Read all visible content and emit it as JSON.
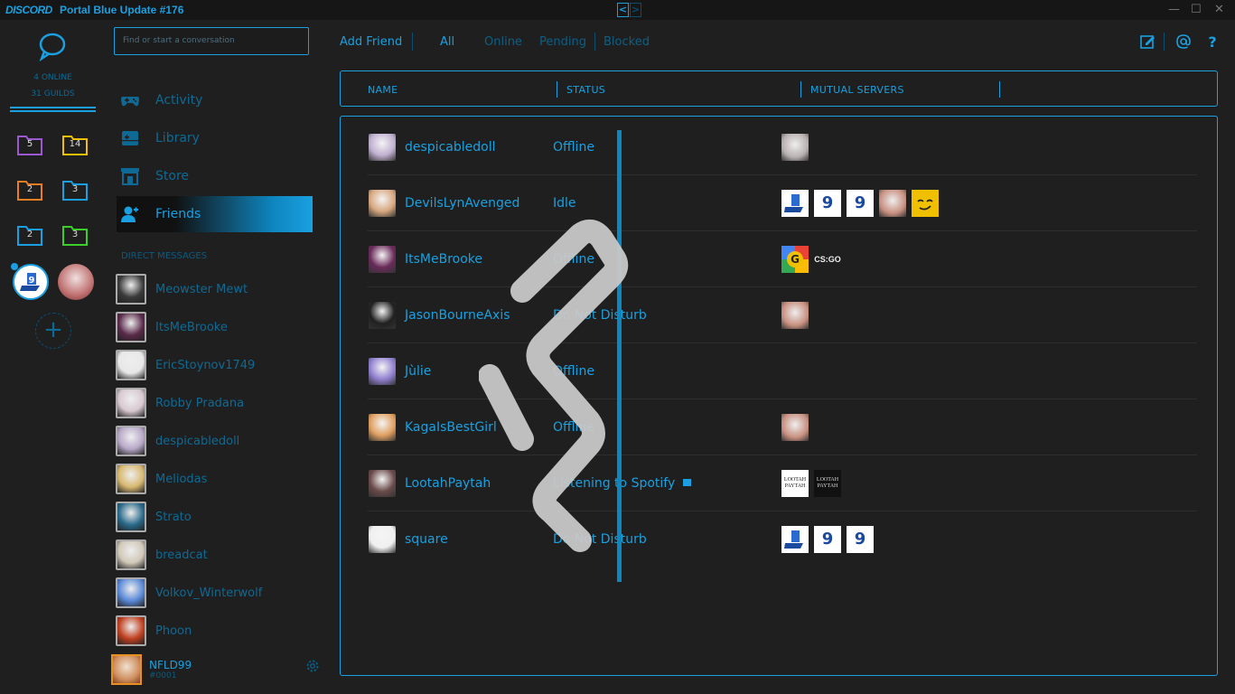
{
  "window": {
    "logo": "DISCORD",
    "title": "Portal Blue Update #176",
    "nav_back": "<",
    "nav_forward": ">",
    "minimize": "—",
    "maximize": "☐",
    "close": "✕"
  },
  "guilds": {
    "online_count": "4 ONLINE",
    "guild_count": "31 GUILDS",
    "folders": [
      {
        "count": "5",
        "color": "#9b59d0"
      },
      {
        "count": "14",
        "color": "#f0c000"
      },
      {
        "count": "2",
        "color": "#e87e22"
      },
      {
        "count": "3",
        "color": "#1aa0e0"
      },
      {
        "count": "2",
        "color": "#1aa0e0"
      },
      {
        "count": "3",
        "color": "#3ccf2a"
      }
    ],
    "add_label": "+"
  },
  "sidebar": {
    "search_placeholder": "Find or start a conversation",
    "nav": [
      {
        "label": "Activity",
        "icon": "gamepad-icon"
      },
      {
        "label": "Library",
        "icon": "library-icon"
      },
      {
        "label": "Store",
        "icon": "store-icon"
      },
      {
        "label": "Friends",
        "icon": "friends-icon"
      }
    ],
    "dm_header": "DIRECT MESSAGES",
    "dms": [
      {
        "name": "Meowster Mewt",
        "color": "#3a3a3a"
      },
      {
        "name": "ItsMeBrooke",
        "color": "#5a2a4a"
      },
      {
        "name": "EricStoynov1749",
        "color": "#e8e8e8"
      },
      {
        "name": "Robby Pradana",
        "color": "#d8c8d0"
      },
      {
        "name": "despicabledoll",
        "color": "#b8a8c8"
      },
      {
        "name": "Meliodas",
        "color": "#d8b870"
      },
      {
        "name": "Strato",
        "color": "#2a6a8a"
      },
      {
        "name": "breadcat",
        "color": "#d0c8b8"
      },
      {
        "name": "Volkov_Winterwolf",
        "color": "#5a8ad8"
      },
      {
        "name": "Phoon",
        "color": "#c04020"
      }
    ],
    "user": {
      "name": "NFLD99",
      "tag": "#0001"
    }
  },
  "topnav": {
    "add_friend": "Add Friend",
    "tabs": [
      "All",
      "Online",
      "Pending",
      "Blocked"
    ]
  },
  "table": {
    "headers": [
      "NAME",
      "STATUS",
      "MUTUAL SERVERS"
    ],
    "rows": [
      {
        "name": "despicabledoll",
        "status": "Offline",
        "avatar": "#c0b0d0",
        "servers": [
          "#b8b0b0"
        ]
      },
      {
        "name": "DevilsLynAvenged",
        "status": "Idle",
        "avatar": "#d8a880",
        "servers": [
          "portal",
          "9d",
          "9d",
          "#c89080",
          "emoji"
        ]
      },
      {
        "name": "ItsMeBrooke",
        "status": "Offline",
        "avatar": "#6a2a5a",
        "servers": [
          "google",
          "csgo"
        ]
      },
      {
        "name": "JasonBourneAxis",
        "status": "Do Not Disturb",
        "avatar": "#202020",
        "servers": [
          "#c89080"
        ]
      },
      {
        "name": "Jùlie",
        "status": "Offline",
        "avatar": "#9080d0",
        "servers": []
      },
      {
        "name": "KagaIsBestGirl",
        "status": "Offline",
        "avatar": "#e0a060",
        "servers": [
          "#c89080"
        ]
      },
      {
        "name": "LootahPaytah",
        "status": "Listening to Spotify",
        "avatar": "#6a4a4a",
        "servers": [
          "lootah-light",
          "lootah-dark"
        ]
      },
      {
        "name": "square",
        "status": "Do Not Disturb",
        "avatar": "#f0f0f0",
        "servers": [
          "portal",
          "9d",
          "9d"
        ]
      }
    ],
    "server_text": {
      "google": "G",
      "csgo": "CS:GO",
      "9d": "9",
      "lootah": "LOOTAH\nPAYTAH"
    }
  }
}
